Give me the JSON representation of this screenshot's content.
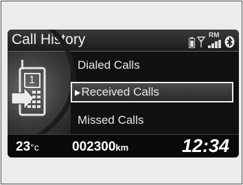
{
  "title": "Call History",
  "status": {
    "signal_label": "RM"
  },
  "phone_badge": "1",
  "menu": [
    {
      "label": "Dialed Calls",
      "selected": false
    },
    {
      "label": "Received Calls",
      "selected": true
    },
    {
      "label": "Missed Calls",
      "selected": false
    }
  ],
  "bottom": {
    "temperature": "23",
    "temp_unit": "°c",
    "odometer": "002300",
    "odo_unit": "km",
    "clock": "12:34"
  }
}
